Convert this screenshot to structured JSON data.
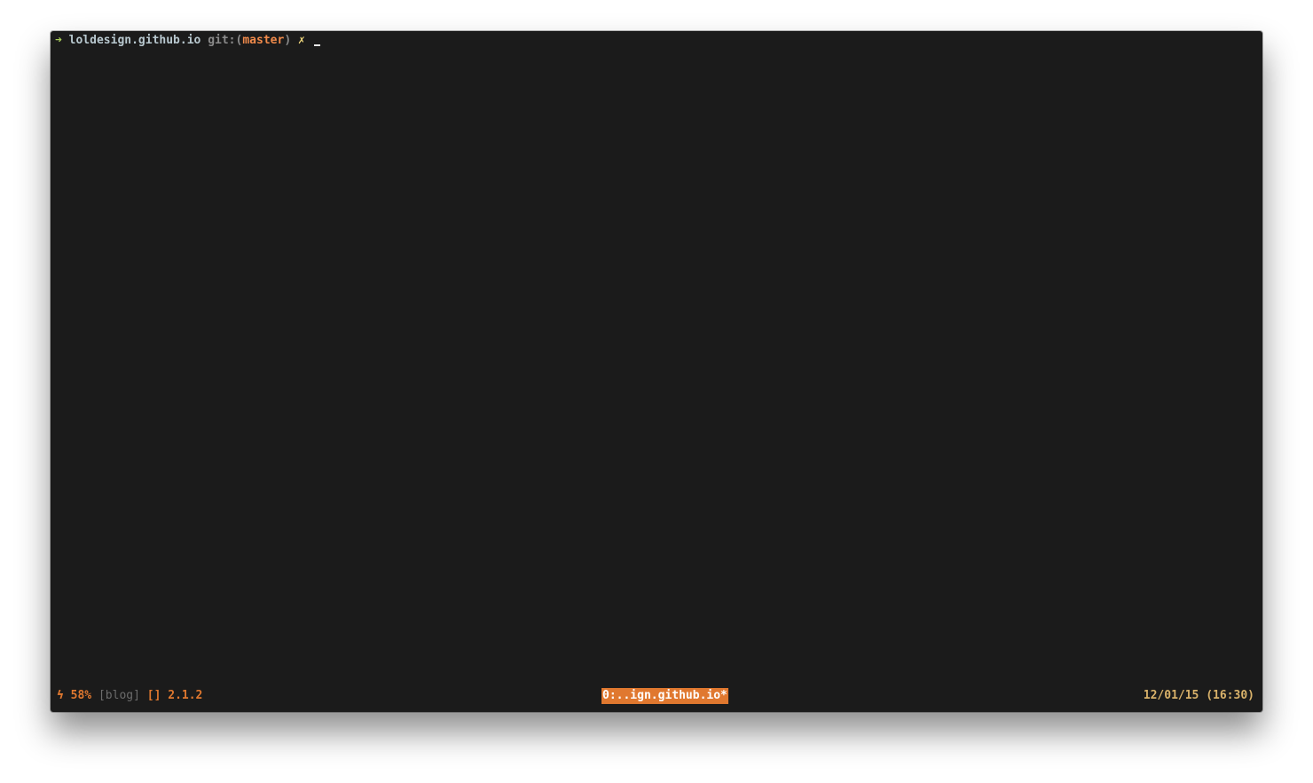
{
  "prompt": {
    "arrow": "➜",
    "directory": "loldesign.github.io",
    "git_label": "git:",
    "paren_open": "(",
    "branch": "master",
    "paren_close": ")",
    "dirty_marker": "✗"
  },
  "statusbar": {
    "battery_icon": "ϟ",
    "battery_percent": "58%",
    "session_name": "[blog]",
    "empty_brackets": "[]",
    "version": "2.1.2",
    "window_tab": "0:..ign.github.io*",
    "datetime": "12/01/15 (16:30)"
  },
  "colors": {
    "background": "#1b1b1b",
    "accent_orange": "#e0782f",
    "prompt_arrow": "#a8cc5a",
    "branch": "#f08a4b",
    "dirty": "#f0d77c",
    "datetime": "#d9b26a"
  }
}
